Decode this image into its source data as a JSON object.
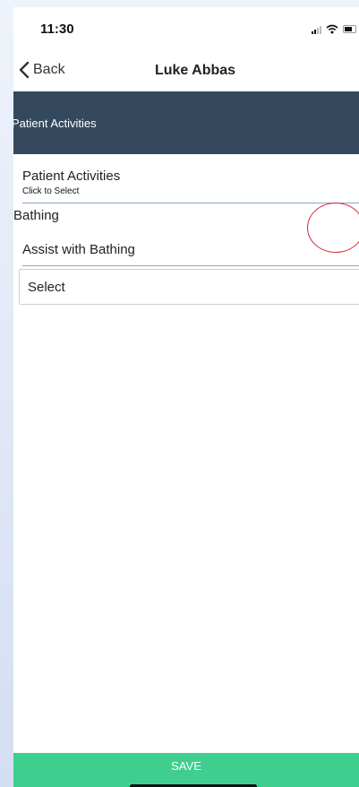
{
  "status_bar": {
    "time": "11:30",
    "icons": [
      "signal-icon",
      "wifi-icon",
      "battery-icon"
    ]
  },
  "nav": {
    "back_label": "Back",
    "title": "Luke Abbas"
  },
  "section": {
    "header": "Patient Activities"
  },
  "activities_select": {
    "label": "Patient Activities",
    "hint": "Click to Select"
  },
  "activity": {
    "name": "Bathing",
    "field_label": "Assist with Bathing",
    "select_value": "Select"
  },
  "footer": {
    "save_label": "SAVE"
  },
  "colors": {
    "header_bg": "#34495e",
    "save_bg": "#3ecf8e",
    "underline": "#8aa4d8",
    "annotation": "#d7263d"
  }
}
